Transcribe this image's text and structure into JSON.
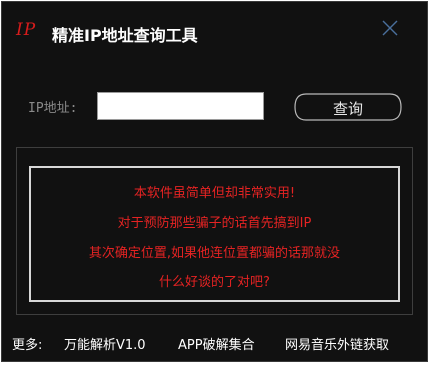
{
  "app": {
    "logo_text": "IP",
    "title": "精准IP地址查询工具",
    "accent_color": "#d81c1c"
  },
  "titlebar": {
    "close_icon": "close-icon"
  },
  "form": {
    "ip_label": "IP地址:",
    "ip_value": "",
    "query_label": "查询"
  },
  "notice": {
    "lines": [
      "本软件虽简单但却非常实用!",
      "对于预防那些骗子的话首先搞到IP",
      "其次确定位置,如果他连位置都骗的话那就没",
      "什么好谈的了对吧?"
    ],
    "text_color": "#e52323"
  },
  "footer": {
    "more_label": "更多:",
    "links": [
      "万能解析V1.0",
      "APP破解集合",
      "网易音乐外链获取"
    ]
  }
}
